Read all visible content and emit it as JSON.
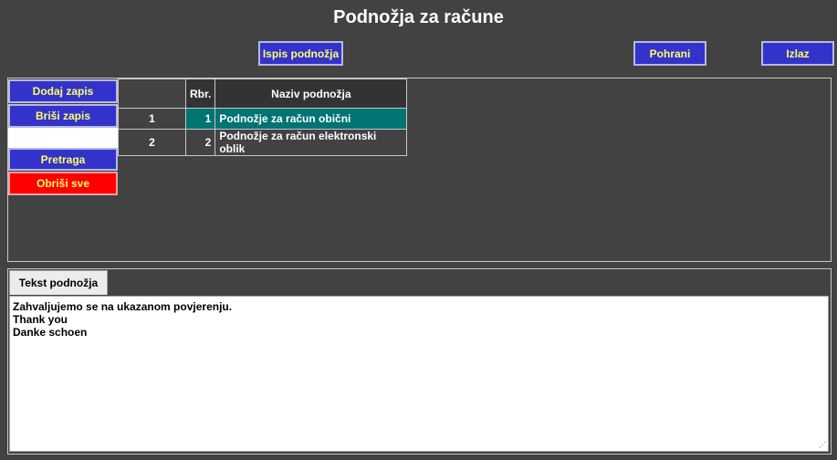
{
  "page": {
    "title": "Podnožja za račune"
  },
  "toolbar": {
    "print_label": "Ispis podnožja",
    "save_label": "Pohrani",
    "exit_label": "Izlaz"
  },
  "side_buttons": {
    "add_label": "Dodaj zapis",
    "delete_label": "Briši zapis",
    "search_label": "Pretraga",
    "clear_label": "Obriši sve"
  },
  "grid": {
    "headers": {
      "index": "",
      "rbr": "Rbr.",
      "naziv": "Naziv podnožja"
    },
    "rows": [
      {
        "index": "1",
        "rbr": "1",
        "naziv": "Podnožje za račun obični",
        "selected": true
      },
      {
        "index": "2",
        "rbr": "2",
        "naziv": "Podnožje za račun elektronski oblik",
        "selected": false
      }
    ]
  },
  "footer_text": {
    "tab_label": "Tekst podnožja",
    "lines": [
      "Zahvaljujemo se na ukazanom povjerenju.",
      "Thank you",
      "Danke schoen"
    ]
  },
  "colors": {
    "background": "#424242",
    "button": "#3333cc",
    "button_text": "#ffff66",
    "danger": "#ff0000",
    "selected_row": "#007373"
  }
}
